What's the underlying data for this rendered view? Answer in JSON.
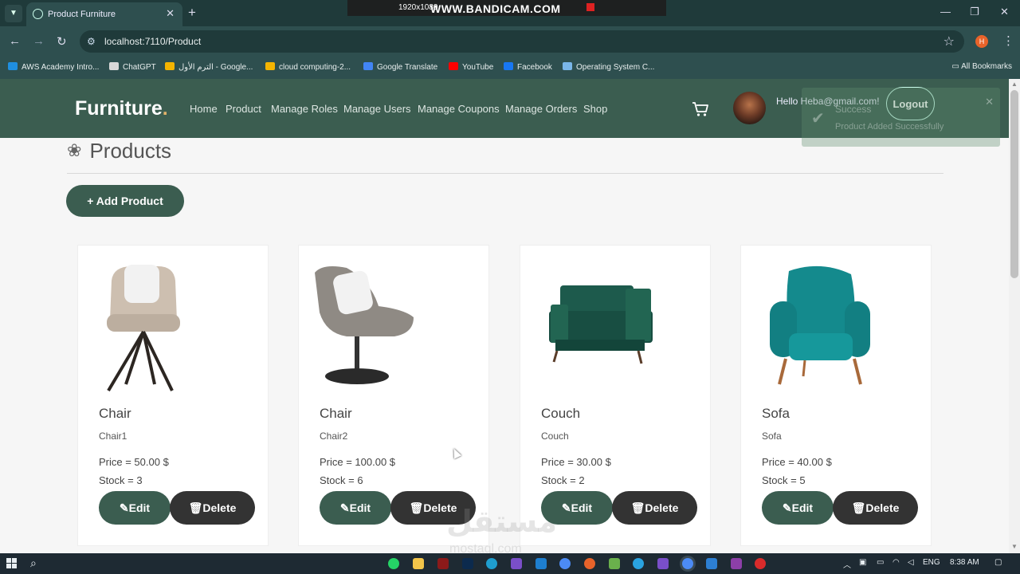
{
  "browser": {
    "tab_title": "Product Furniture",
    "url": "localhost:7110/Product",
    "profile_initial": "H",
    "recorder": {
      "resolution": "1920x1080",
      "brand": "WWW.BANDICAM.COM"
    },
    "bookmarks": [
      {
        "label": "AWS Academy Intro...",
        "color": "#1f8fe0"
      },
      {
        "label": "ChatGPT",
        "color": "#d8d8d8"
      },
      {
        "label": "الترم الأول - Google...",
        "color": "#f4b400"
      },
      {
        "label": "cloud computing-2...",
        "color": "#f4b400"
      },
      {
        "label": "Google Translate",
        "color": "#4285f4"
      },
      {
        "label": "YouTube",
        "color": "#ff0000"
      },
      {
        "label": "Facebook",
        "color": "#1877f2"
      },
      {
        "label": "Operating System C...",
        "color": "#7ab6e8"
      }
    ],
    "all_bookmarks": "All Bookmarks"
  },
  "site": {
    "logo": "Furniture",
    "logo_dot": ".",
    "nav": [
      "Home",
      "Product",
      "Manage Roles",
      "Manage Users",
      "Manage Coupons",
      "Manage Orders",
      "Shop"
    ],
    "greeting": "Hello Heba@gmail.com!",
    "logout_label": "Logout",
    "toast": {
      "title": "Success",
      "message": "Product Added Successfully"
    }
  },
  "page": {
    "title": "Products",
    "add_button": "+ Add Product",
    "edit_label": "Edit",
    "delete_label": "Delete",
    "products": [
      {
        "name": "Chair",
        "desc": "Chair1",
        "price": "Price = 50.00 $",
        "stock": "Stock = 3"
      },
      {
        "name": "Chair",
        "desc": "Chair2",
        "price": "Price = 100.00 $",
        "stock": "Stock = 6"
      },
      {
        "name": "Couch",
        "desc": "Couch",
        "price": "Price = 30.00 $",
        "stock": "Stock = 2"
      },
      {
        "name": "Sofa",
        "desc": "Sofa",
        "price": "Price = 40.00 $",
        "stock": "Stock = 5"
      }
    ]
  },
  "watermark": {
    "main": "مستقل",
    "sub": "mostaql.com"
  },
  "taskbar": {
    "lang": "ENG",
    "time": "8:38 AM"
  }
}
